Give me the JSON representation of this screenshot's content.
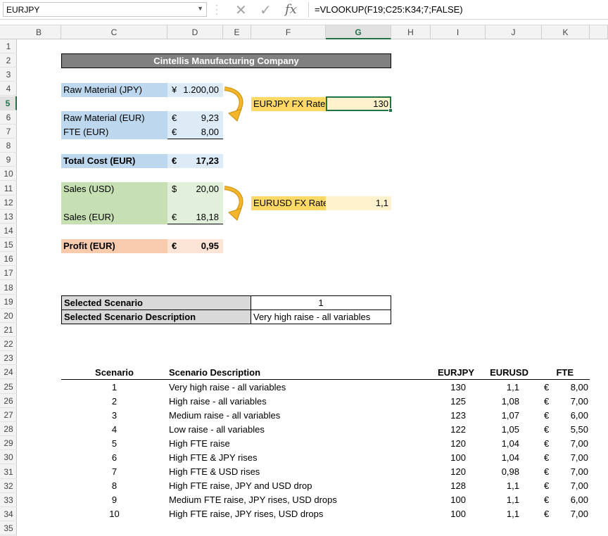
{
  "formula_bar": {
    "name_box": "EURJPY",
    "formula": "=VLOOKUP(F19;C25:K34;7;FALSE)",
    "fx_label": "fx"
  },
  "columns": [
    "B",
    "C",
    "D",
    "E",
    "F",
    "G",
    "H",
    "I",
    "J",
    "K"
  ],
  "selected_column": "G",
  "selected_row": "5",
  "rows": [
    "1",
    "2",
    "3",
    "4",
    "5",
    "6",
    "7",
    "8",
    "9",
    "10",
    "11",
    "12",
    "13",
    "14",
    "15",
    "16",
    "17",
    "18",
    "19",
    "20",
    "21",
    "22",
    "23",
    "24",
    "25",
    "26",
    "27",
    "28",
    "29",
    "30",
    "31",
    "32",
    "33",
    "34",
    "35"
  ],
  "sheet": {
    "company": "Cintellis Manufacturing Company",
    "raw_material_jpy_label": "Raw Material (JPY)",
    "raw_material_jpy_sym": "¥",
    "raw_material_jpy_val": "1.200,00",
    "eurjpy_label": "EURJPY FX Rate",
    "eurjpy_val": "130",
    "raw_material_eur_label": "Raw Material (EUR)",
    "raw_material_eur_sym": "€",
    "raw_material_eur_val": "9,23",
    "fte_label": "FTE (EUR)",
    "fte_sym": "€",
    "fte_val": "8,00",
    "total_cost_label": "Total Cost (EUR)",
    "total_cost_sym": "€",
    "total_cost_val": "17,23",
    "sales_usd_label": "Sales (USD)",
    "sales_usd_sym": "$",
    "sales_usd_val": "20,00",
    "eurusd_label": "EURUSD FX Rate",
    "eurusd_val": "1,1",
    "sales_eur_label": "Sales (EUR)",
    "sales_eur_sym": "€",
    "sales_eur_val": "18,18",
    "profit_label": "Profit (EUR)",
    "profit_sym": "€",
    "profit_val": "0,95",
    "selected_scenario_label": "Selected Scenario",
    "selected_scenario_val": "1",
    "selected_desc_label": "Selected Scenario Description",
    "selected_desc_val": "Very high raise - all variables"
  },
  "scenario_table": {
    "headers": {
      "scenario": "Scenario",
      "description": "Scenario Description",
      "eurjpy": "EURJPY",
      "eurusd": "EURUSD",
      "fte": "FTE"
    },
    "rows": [
      {
        "n": "1",
        "desc": "Very high raise - all variables",
        "eurjpy": "130",
        "eurusd": "1,1",
        "sym": "€",
        "fte": "8,00"
      },
      {
        "n": "2",
        "desc": "High raise - all variables",
        "eurjpy": "125",
        "eurusd": "1,08",
        "sym": "€",
        "fte": "7,00"
      },
      {
        "n": "3",
        "desc": "Medium raise - all variables",
        "eurjpy": "123",
        "eurusd": "1,07",
        "sym": "€",
        "fte": "6,00"
      },
      {
        "n": "4",
        "desc": "Low raise - all variables",
        "eurjpy": "122",
        "eurusd": "1,05",
        "sym": "€",
        "fte": "5,50"
      },
      {
        "n": "5",
        "desc": "High FTE raise",
        "eurjpy": "120",
        "eurusd": "1,04",
        "sym": "€",
        "fte": "7,00"
      },
      {
        "n": "6",
        "desc": "High FTE & JPY rises",
        "eurjpy": "100",
        "eurusd": "1,04",
        "sym": "€",
        "fte": "7,00"
      },
      {
        "n": "7",
        "desc": "High FTE & USD rises",
        "eurjpy": "120",
        "eurusd": "0,98",
        "sym": "€",
        "fte": "7,00"
      },
      {
        "n": "8",
        "desc": "High FTE raise, JPY and USD drop",
        "eurjpy": "128",
        "eurusd": "1,1",
        "sym": "€",
        "fte": "7,00"
      },
      {
        "n": "9",
        "desc": "Medium FTE raise, JPY rises, USD drops",
        "eurjpy": "100",
        "eurusd": "1,1",
        "sym": "€",
        "fte": "6,00"
      },
      {
        "n": "10",
        "desc": "High FTE raise, JPY rises, USD drops",
        "eurjpy": "100",
        "eurusd": "1,1",
        "sym": "€",
        "fte": "7,00"
      }
    ]
  }
}
